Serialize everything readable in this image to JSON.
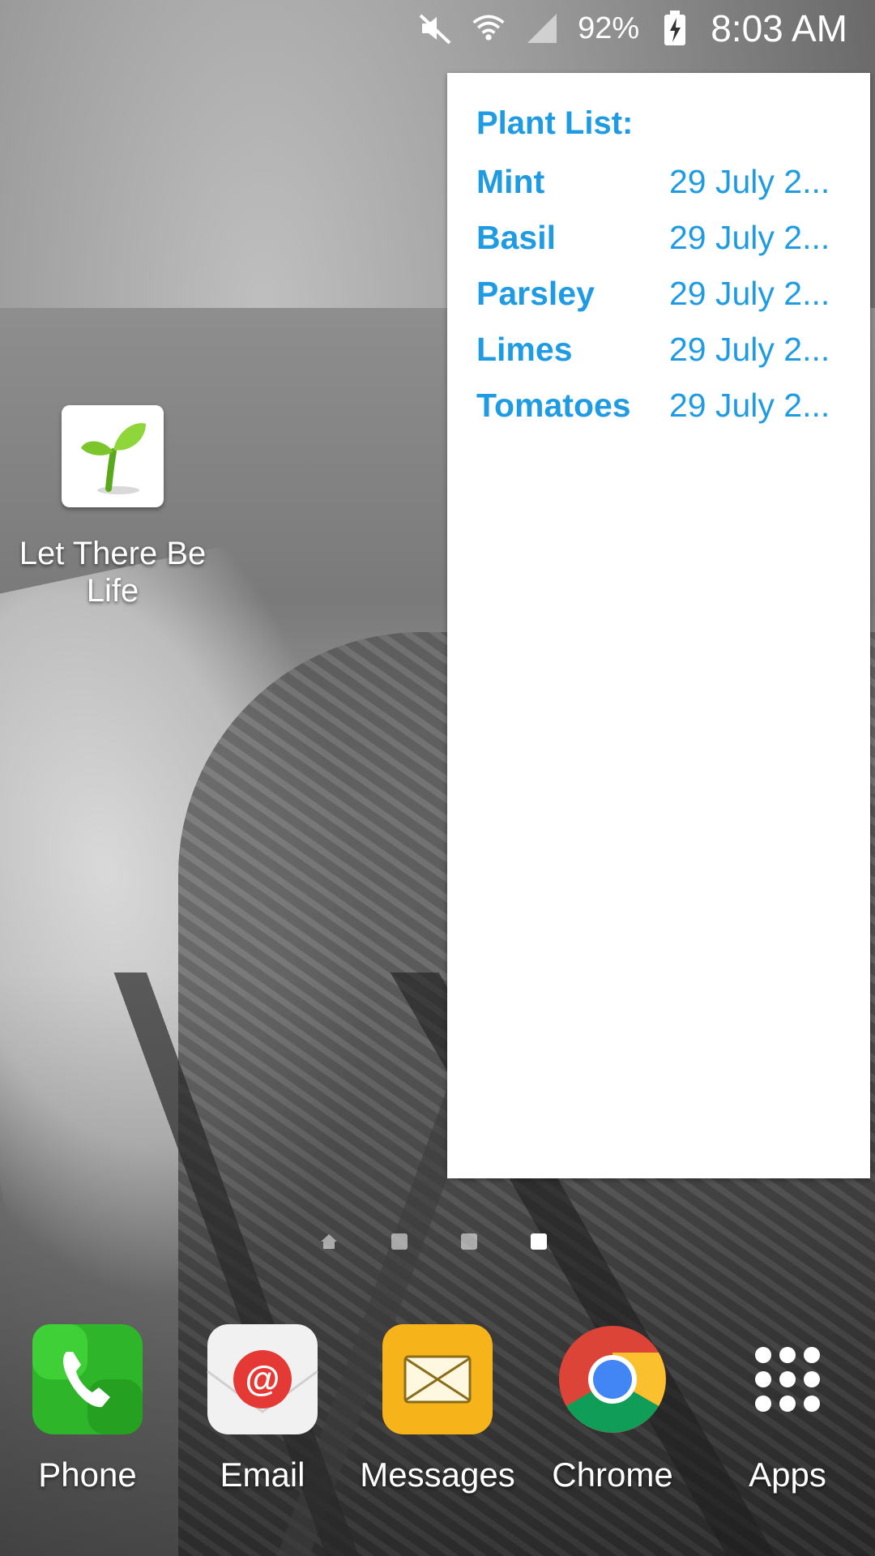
{
  "status_bar": {
    "battery_percent": "92%",
    "time": "8:03 AM",
    "icons": [
      "mute-icon",
      "wifi-icon",
      "signal-icon",
      "battery-charging-icon"
    ]
  },
  "widget": {
    "title": "Plant List:",
    "rows": [
      {
        "name": "Mint",
        "date": "29 July 2..."
      },
      {
        "name": "Basil",
        "date": "29 July 2..."
      },
      {
        "name": "Parsley",
        "date": "29 July 2..."
      },
      {
        "name": "Limes",
        "date": "29 July 2..."
      },
      {
        "name": "Tomatoes",
        "date": "29 July 2..."
      }
    ]
  },
  "desktop_shortcut": {
    "label": "Let There Be Life",
    "icon": "plant-sprout-icon"
  },
  "page_indicator": {
    "pages": 4,
    "active_index": 3
  },
  "dock": {
    "items": [
      {
        "label": "Phone",
        "icon": "phone-icon",
        "color": "#2fb52a"
      },
      {
        "label": "Email",
        "icon": "email-at-icon",
        "color": "#e53935"
      },
      {
        "label": "Messages",
        "icon": "messages-envelope-icon",
        "color": "#f6b41a"
      },
      {
        "label": "Chrome",
        "icon": "chrome-icon",
        "color": "#4285f4"
      },
      {
        "label": "Apps",
        "icon": "apps-grid-icon",
        "color": "#ffffff"
      }
    ]
  },
  "colors": {
    "widget_text": "#1e9be3",
    "widget_bg": "#ffffff"
  }
}
